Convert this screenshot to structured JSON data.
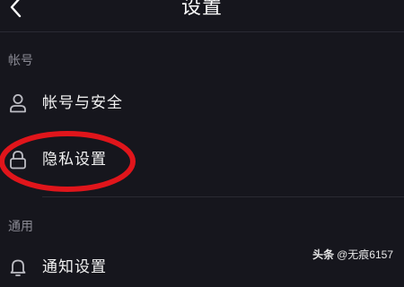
{
  "header": {
    "title": "设置",
    "back_icon": "chevron-left-icon"
  },
  "sections": [
    {
      "title": "帐号",
      "items": [
        {
          "label": "帐号与安全",
          "icon": "user-icon"
        },
        {
          "label": "隐私设置",
          "icon": "lock-icon"
        }
      ]
    },
    {
      "title": "通用",
      "items": [
        {
          "label": "通知设置",
          "icon": "bell-icon"
        }
      ]
    }
  ],
  "annotation": {
    "highlight_color": "#e0151b",
    "highlighted_item": "隐私设置"
  },
  "watermark": {
    "brand": "头条",
    "handle": "@无痕6157"
  },
  "colors": {
    "background": "#16161d",
    "text": "#f2f2f2",
    "section_title": "#8a8a94",
    "divider": "#2a2a33"
  }
}
